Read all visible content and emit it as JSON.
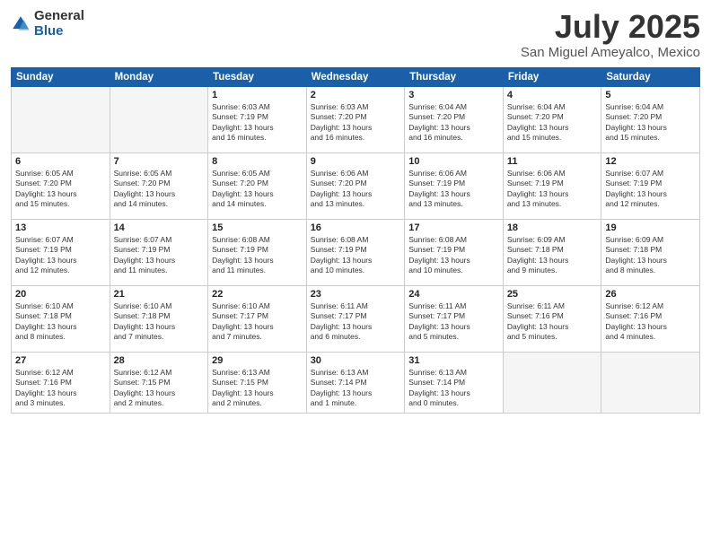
{
  "logo": {
    "general": "General",
    "blue": "Blue"
  },
  "title": "July 2025",
  "subtitle": "San Miguel Ameyalco, Mexico",
  "headers": [
    "Sunday",
    "Monday",
    "Tuesday",
    "Wednesday",
    "Thursday",
    "Friday",
    "Saturday"
  ],
  "weeks": [
    [
      {
        "day": "",
        "info": ""
      },
      {
        "day": "",
        "info": ""
      },
      {
        "day": "1",
        "info": "Sunrise: 6:03 AM\nSunset: 7:19 PM\nDaylight: 13 hours\nand 16 minutes."
      },
      {
        "day": "2",
        "info": "Sunrise: 6:03 AM\nSunset: 7:20 PM\nDaylight: 13 hours\nand 16 minutes."
      },
      {
        "day": "3",
        "info": "Sunrise: 6:04 AM\nSunset: 7:20 PM\nDaylight: 13 hours\nand 16 minutes."
      },
      {
        "day": "4",
        "info": "Sunrise: 6:04 AM\nSunset: 7:20 PM\nDaylight: 13 hours\nand 15 minutes."
      },
      {
        "day": "5",
        "info": "Sunrise: 6:04 AM\nSunset: 7:20 PM\nDaylight: 13 hours\nand 15 minutes."
      }
    ],
    [
      {
        "day": "6",
        "info": "Sunrise: 6:05 AM\nSunset: 7:20 PM\nDaylight: 13 hours\nand 15 minutes."
      },
      {
        "day": "7",
        "info": "Sunrise: 6:05 AM\nSunset: 7:20 PM\nDaylight: 13 hours\nand 14 minutes."
      },
      {
        "day": "8",
        "info": "Sunrise: 6:05 AM\nSunset: 7:20 PM\nDaylight: 13 hours\nand 14 minutes."
      },
      {
        "day": "9",
        "info": "Sunrise: 6:06 AM\nSunset: 7:20 PM\nDaylight: 13 hours\nand 13 minutes."
      },
      {
        "day": "10",
        "info": "Sunrise: 6:06 AM\nSunset: 7:19 PM\nDaylight: 13 hours\nand 13 minutes."
      },
      {
        "day": "11",
        "info": "Sunrise: 6:06 AM\nSunset: 7:19 PM\nDaylight: 13 hours\nand 13 minutes."
      },
      {
        "day": "12",
        "info": "Sunrise: 6:07 AM\nSunset: 7:19 PM\nDaylight: 13 hours\nand 12 minutes."
      }
    ],
    [
      {
        "day": "13",
        "info": "Sunrise: 6:07 AM\nSunset: 7:19 PM\nDaylight: 13 hours\nand 12 minutes."
      },
      {
        "day": "14",
        "info": "Sunrise: 6:07 AM\nSunset: 7:19 PM\nDaylight: 13 hours\nand 11 minutes."
      },
      {
        "day": "15",
        "info": "Sunrise: 6:08 AM\nSunset: 7:19 PM\nDaylight: 13 hours\nand 11 minutes."
      },
      {
        "day": "16",
        "info": "Sunrise: 6:08 AM\nSunset: 7:19 PM\nDaylight: 13 hours\nand 10 minutes."
      },
      {
        "day": "17",
        "info": "Sunrise: 6:08 AM\nSunset: 7:19 PM\nDaylight: 13 hours\nand 10 minutes."
      },
      {
        "day": "18",
        "info": "Sunrise: 6:09 AM\nSunset: 7:18 PM\nDaylight: 13 hours\nand 9 minutes."
      },
      {
        "day": "19",
        "info": "Sunrise: 6:09 AM\nSunset: 7:18 PM\nDaylight: 13 hours\nand 8 minutes."
      }
    ],
    [
      {
        "day": "20",
        "info": "Sunrise: 6:10 AM\nSunset: 7:18 PM\nDaylight: 13 hours\nand 8 minutes."
      },
      {
        "day": "21",
        "info": "Sunrise: 6:10 AM\nSunset: 7:18 PM\nDaylight: 13 hours\nand 7 minutes."
      },
      {
        "day": "22",
        "info": "Sunrise: 6:10 AM\nSunset: 7:17 PM\nDaylight: 13 hours\nand 7 minutes."
      },
      {
        "day": "23",
        "info": "Sunrise: 6:11 AM\nSunset: 7:17 PM\nDaylight: 13 hours\nand 6 minutes."
      },
      {
        "day": "24",
        "info": "Sunrise: 6:11 AM\nSunset: 7:17 PM\nDaylight: 13 hours\nand 5 minutes."
      },
      {
        "day": "25",
        "info": "Sunrise: 6:11 AM\nSunset: 7:16 PM\nDaylight: 13 hours\nand 5 minutes."
      },
      {
        "day": "26",
        "info": "Sunrise: 6:12 AM\nSunset: 7:16 PM\nDaylight: 13 hours\nand 4 minutes."
      }
    ],
    [
      {
        "day": "27",
        "info": "Sunrise: 6:12 AM\nSunset: 7:16 PM\nDaylight: 13 hours\nand 3 minutes."
      },
      {
        "day": "28",
        "info": "Sunrise: 6:12 AM\nSunset: 7:15 PM\nDaylight: 13 hours\nand 2 minutes."
      },
      {
        "day": "29",
        "info": "Sunrise: 6:13 AM\nSunset: 7:15 PM\nDaylight: 13 hours\nand 2 minutes."
      },
      {
        "day": "30",
        "info": "Sunrise: 6:13 AM\nSunset: 7:14 PM\nDaylight: 13 hours\nand 1 minute."
      },
      {
        "day": "31",
        "info": "Sunrise: 6:13 AM\nSunset: 7:14 PM\nDaylight: 13 hours\nand 0 minutes."
      },
      {
        "day": "",
        "info": ""
      },
      {
        "day": "",
        "info": ""
      }
    ]
  ]
}
